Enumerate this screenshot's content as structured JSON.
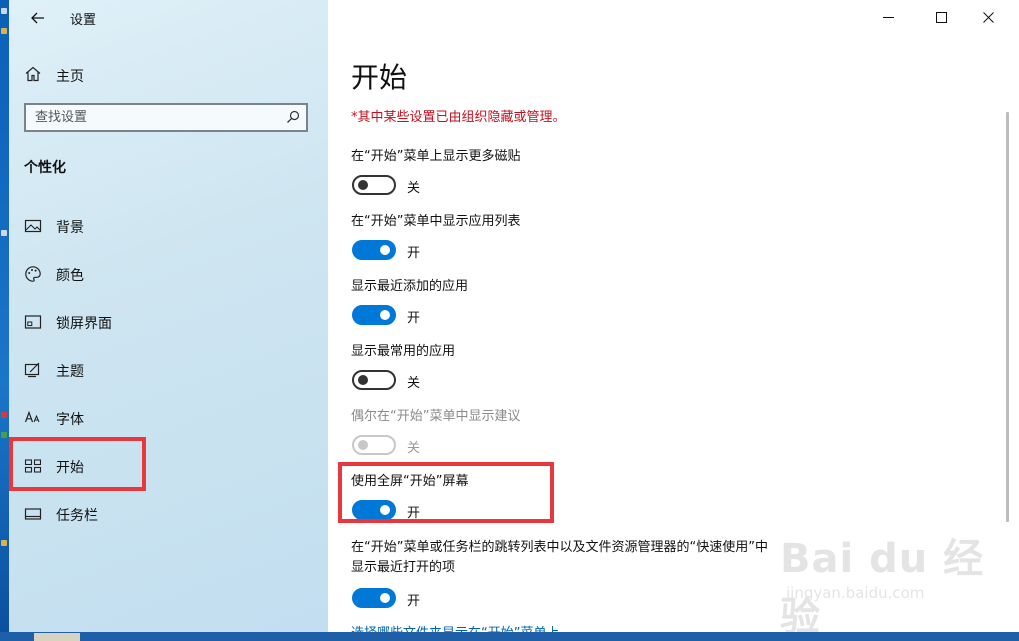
{
  "window": {
    "title": "设置",
    "minimize_icon": "minimize-icon",
    "maximize_icon": "maximize-icon",
    "close_icon": "close-icon"
  },
  "sidebar": {
    "home_label": "主页",
    "search_placeholder": "查找设置",
    "section_title": "个性化",
    "items": [
      {
        "label": "背景",
        "icon": "picture-icon"
      },
      {
        "label": "颜色",
        "icon": "palette-icon"
      },
      {
        "label": "锁屏界面",
        "icon": "lock-screen-icon"
      },
      {
        "label": "主题",
        "icon": "theme-icon"
      },
      {
        "label": "字体",
        "icon": "font-icon"
      },
      {
        "label": "开始",
        "icon": "start-icon",
        "selected": true
      },
      {
        "label": "任务栏",
        "icon": "taskbar-icon"
      }
    ]
  },
  "main": {
    "title": "开始",
    "warning": "*其中某些设置已由组织隐藏或管理。",
    "settings": [
      {
        "label": "在“开始”菜单上显示更多磁贴",
        "state": "关",
        "on": false,
        "enabled": true
      },
      {
        "label": "在“开始”菜单中显示应用列表",
        "state": "开",
        "on": true,
        "enabled": true
      },
      {
        "label": "显示最近添加的应用",
        "state": "开",
        "on": true,
        "enabled": true
      },
      {
        "label": "显示最常用的应用",
        "state": "关",
        "on": false,
        "enabled": true
      },
      {
        "label": "偶尔在“开始”菜单中显示建议",
        "state": "关",
        "on": false,
        "enabled": false
      },
      {
        "label": "使用全屏“开始”屏幕",
        "state": "开",
        "on": true,
        "enabled": true
      },
      {
        "label_line1": "在“开始”菜单或任务栏的跳转列表中以及文件资源管理器的“快速使用”中",
        "label_line2": "显示最近打开的项",
        "state": "开",
        "on": true,
        "enabled": true
      }
    ],
    "link": "选择哪些文件夹显示在“开始”菜单上"
  },
  "watermark": {
    "brand": "Bai du 经验",
    "url": "jingyan.baidu.com"
  },
  "colors": {
    "accent": "#0078d7",
    "warning": "#c50f1f",
    "highlight": "#e8383e",
    "link": "#0063b1"
  }
}
